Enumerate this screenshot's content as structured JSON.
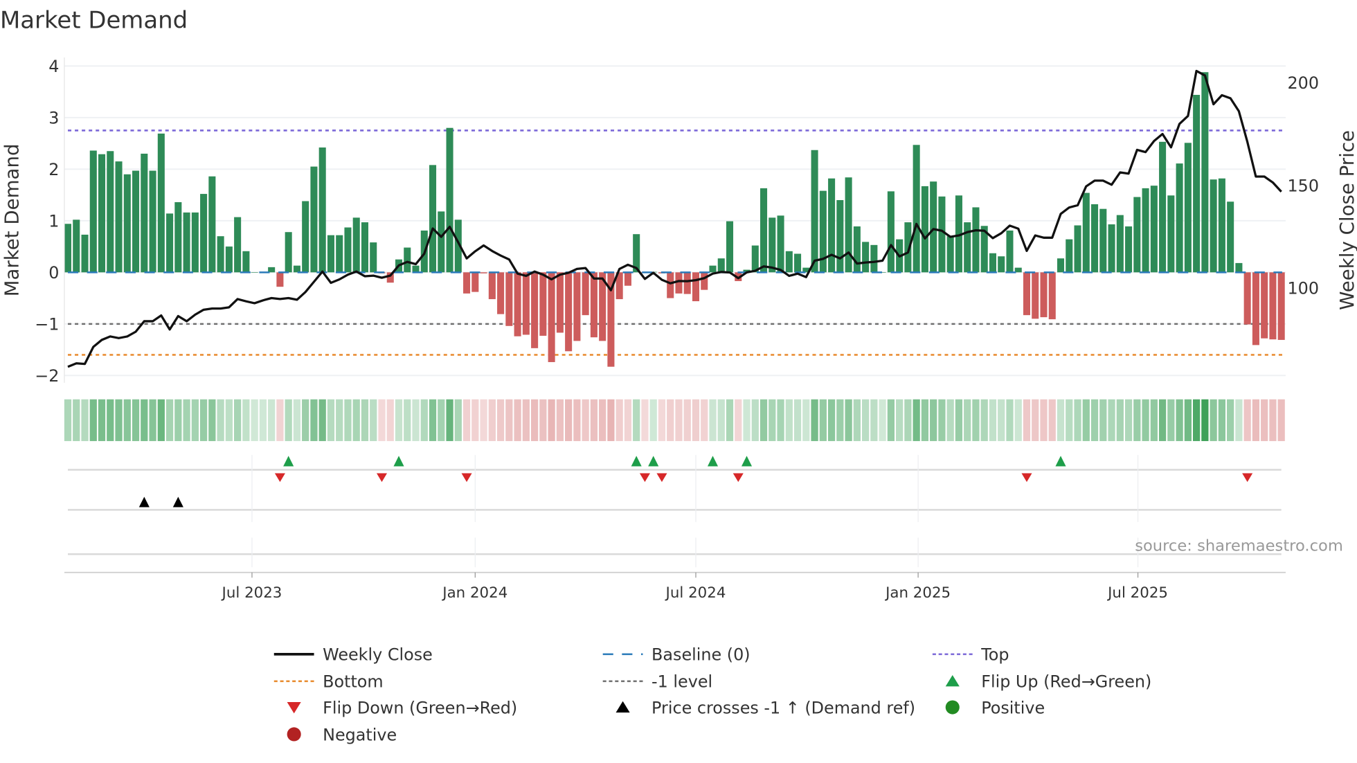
{
  "chart_data": {
    "type": "bar",
    "title": "Market Demand",
    "ylabel": "Market Demand",
    "y2label": "Weekly Close Price",
    "ylim": [
      -2.2,
      4.2
    ],
    "y2lim": [
      50,
      215
    ],
    "yticks": [
      4,
      3,
      2,
      1,
      0,
      -1,
      -2
    ],
    "ytick_labels": [
      "4",
      "3",
      "2",
      "1",
      "0",
      "−1",
      "−2"
    ],
    "y2ticks": [
      200,
      150,
      100
    ],
    "y2tick_labels": [
      "200",
      "150",
      "100"
    ],
    "xticks": [
      {
        "label": "Jul 2023",
        "week": 22.7
      },
      {
        "label": "Jan 2024",
        "week": 49.0
      },
      {
        "label": "Jul 2024",
        "week": 75.0
      },
      {
        "label": "Jan 2025",
        "week": 101.2
      },
      {
        "label": "Jul 2025",
        "week": 127.1
      }
    ],
    "reference_lines": {
      "top": 2.75,
      "minus_one": -1,
      "bottom": -1.6,
      "baseline": 0
    },
    "demand": [
      0.94,
      1.02,
      0.73,
      2.36,
      2.29,
      2.35,
      2.15,
      1.9,
      1.97,
      2.3,
      1.97,
      2.69,
      1.14,
      1.36,
      1.16,
      1.16,
      1.52,
      1.86,
      0.7,
      0.5,
      1.07,
      0.41,
      0.0,
      0.01,
      0.1,
      -0.28,
      0.78,
      0.13,
      1.38,
      2.05,
      2.42,
      0.72,
      0.72,
      0.87,
      1.06,
      0.97,
      0.58,
      -0.02,
      -0.2,
      0.25,
      0.48,
      0.13,
      0.81,
      2.08,
      1.18,
      2.8,
      1.02,
      -0.41,
      -0.38,
      -0.02,
      -0.52,
      -0.81,
      -1.04,
      -1.24,
      -1.21,
      -1.47,
      -1.23,
      -1.74,
      -1.17,
      -1.53,
      -1.33,
      -0.83,
      -1.26,
      -1.33,
      -1.83,
      -0.52,
      -0.26,
      0.74,
      -0.01,
      0.01,
      -0.02,
      -0.5,
      -0.41,
      -0.42,
      -0.56,
      -0.34,
      0.13,
      0.27,
      0.99,
      -0.17,
      0.05,
      0.52,
      1.63,
      1.06,
      1.1,
      0.41,
      0.36,
      0.09,
      2.37,
      1.58,
      1.82,
      1.4,
      1.84,
      0.89,
      0.59,
      0.53,
      0.0,
      1.57,
      0.64,
      0.97,
      2.47,
      1.67,
      1.76,
      1.47,
      0.7,
      1.49,
      0.97,
      1.26,
      0.9,
      0.37,
      0.31,
      0.81,
      0.09,
      -0.83,
      -0.9,
      -0.87,
      -0.91,
      0.27,
      0.64,
      0.91,
      1.54,
      1.32,
      1.23,
      0.93,
      1.11,
      0.89,
      1.46,
      1.63,
      1.68,
      2.53,
      1.49,
      2.11,
      2.51,
      3.44,
      3.88,
      1.8,
      1.82,
      1.37,
      0.18,
      -1.01,
      -1.41,
      -1.28,
      -1.3,
      -1.31
    ],
    "weekly_close": [
      61.6,
      63.3,
      63.0,
      71.3,
      74.7,
      76.4,
      75.6,
      76.4,
      78.7,
      83.8,
      83.8,
      86.6,
      79.8,
      86.3,
      83.8,
      87.0,
      89.4,
      90.0,
      90.0,
      90.6,
      94.6,
      93.5,
      92.6,
      94.0,
      95.1,
      94.6,
      95.1,
      94.3,
      98.0,
      103.0,
      108.0,
      102.5,
      104.2,
      106.5,
      108.0,
      105.7,
      106.0,
      105.0,
      106.0,
      111.0,
      112.7,
      111.6,
      116.7,
      129.0,
      124.9,
      129.8,
      122.3,
      114.4,
      117.9,
      120.7,
      118.0,
      115.8,
      113.9,
      107.0,
      105.9,
      108.0,
      106.5,
      104.2,
      106.5,
      107.4,
      109.3,
      109.7,
      104.6,
      104.6,
      98.9,
      109.3,
      111.3,
      109.7,
      104.4,
      107.4,
      104.0,
      102.3,
      103.4,
      103.3,
      103.8,
      104.8,
      107.0,
      107.8,
      107.6,
      104.8,
      107.6,
      108.4,
      110.5,
      109.9,
      108.8,
      105.9,
      107.0,
      105.3,
      113.3,
      114.2,
      116.2,
      114.4,
      117.3,
      111.9,
      112.4,
      112.7,
      113.3,
      120.9,
      115.4,
      117.3,
      131.2,
      124.1,
      128.7,
      127.9,
      124.9,
      125.6,
      127.2,
      128.1,
      127.9,
      124.3,
      126.7,
      130.4,
      128.9,
      118.1,
      125.6,
      124.5,
      124.5,
      136.1,
      139.2,
      140.3,
      149.5,
      152.3,
      152.3,
      150.3,
      156.3,
      155.7,
      167.3,
      166.2,
      171.6,
      175.0,
      168.5,
      179.9,
      183.8,
      205.7,
      203.5,
      189.5,
      193.9,
      192.4,
      186.1,
      171.1,
      154.3,
      154.3,
      151.4,
      146.9
    ],
    "flip_up_weeks": [
      27,
      40,
      68,
      70,
      77,
      81,
      118
    ],
    "flip_down_weeks": [
      26,
      38,
      48,
      69,
      71,
      80,
      114,
      140
    ],
    "price_cross_weeks": [
      10,
      14
    ],
    "legend": [
      {
        "label": "Weekly Close",
        "kind": "solid-line",
        "color": "#111111"
      },
      {
        "label": "Baseline (0)",
        "kind": "dashed-line",
        "color": "#2a7ab9"
      },
      {
        "label": "Top",
        "kind": "dotted-line",
        "color": "#7b68d8"
      },
      {
        "label": "Bottom",
        "kind": "dotted-line",
        "color": "#e8892b"
      },
      {
        "label": "-1 level",
        "kind": "dotted-line",
        "color": "#6f6f6f"
      },
      {
        "label": "Flip Up (Red→Green)",
        "kind": "triangle-up",
        "color": "#1e9e4a"
      },
      {
        "label": "Flip Down (Green→Red)",
        "kind": "triangle-down",
        "color": "#d62728"
      },
      {
        "label": "Price crosses -1 ↑ (Demand ref)",
        "kind": "triangle-up",
        "color": "#000000"
      },
      {
        "label": "Positive",
        "kind": "circle",
        "color": "#228b22"
      },
      {
        "label": "Negative",
        "kind": "circle",
        "color": "#b22222"
      }
    ],
    "legend_placement": "bottom",
    "source": "source: sharemaestro.com"
  },
  "colors": {
    "positive_bar": "#2e8b57",
    "negative_bar": "#cd5c5c"
  }
}
